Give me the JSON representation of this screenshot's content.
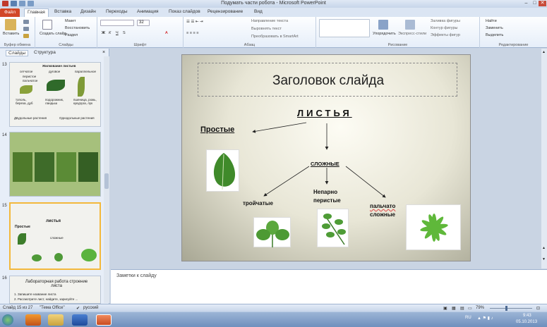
{
  "window": {
    "title": "Подумать части робота - Microsoft PowerPoint"
  },
  "tabs": {
    "file": "Файл",
    "items": [
      "Главная",
      "Вставка",
      "Дизайн",
      "Переходы",
      "Анимация",
      "Показ слайдов",
      "Рецензирование",
      "Вид"
    ]
  },
  "ribbon": {
    "clipboard": {
      "paste": "Вставить",
      "label": "Буфер обмена"
    },
    "slides": {
      "new_slide": "Создать слайд",
      "layout": "Макет",
      "reset": "Восстановить",
      "section": "Раздел",
      "label": "Слайды"
    },
    "font": {
      "size": "32",
      "label": "Шрифт"
    },
    "paragraph": {
      "text_direction": "Направление текста",
      "align_text": "Выровнять текст",
      "smartart": "Преобразовать в SmartArt",
      "label": "Абзац"
    },
    "drawing": {
      "arrange": "Упорядочить",
      "quick_styles": "Экспресс-стили",
      "fill": "Заливка фигуры",
      "outline": "Контур фигуры",
      "effects": "Эффекты фигур",
      "label": "Рисование"
    },
    "editing": {
      "find": "Найти",
      "replace": "Заменить",
      "select": "Выделить",
      "label": "Редактирование"
    }
  },
  "left_panel": {
    "tab_slides": "Слайды",
    "tab_outline": "Структура",
    "thumbs": [
      {
        "num": "13",
        "title": "Жилкование листьев",
        "c1": "сетчатое",
        "c2": "дуговое",
        "c3": "параллельное",
        "t1": "перистое",
        "t2": "пальчатое",
        "l1": "тополь, береза, дуб",
        "l2": "подорожник, ландыш",
        "l3": "пшеница, рожь, кукуруза, лук",
        "b1": "Двудольные растения",
        "b2": "Однодольные растения"
      },
      {
        "num": "14"
      },
      {
        "num": "15",
        "title": "листья",
        "left": "Простые",
        "mid": "сложные"
      },
      {
        "num": "16",
        "title": "Лабораторная работа строение листа",
        "l1": "1. Запишите название листа",
        "l2": "2. Рассмотрите лист, найдите, зарисуйте ..."
      }
    ]
  },
  "slide": {
    "title": "Заголовок слайда",
    "main": "ЛИСТЬЯ",
    "simple": "Простые",
    "compound": "СЛОЖНЫЕ",
    "trifoliate": "тройчатые",
    "pinnate_1": "Непарно",
    "pinnate_2": "перистые",
    "palmate_1": "пальчато",
    "palmate_2": "сложные"
  },
  "notes": {
    "placeholder": "Заметки к слайду"
  },
  "status": {
    "slide_counter": "Слайд 15 из 27",
    "theme": "\"Тема Office\"",
    "language": "русский",
    "zoom": "79%"
  },
  "taskbar": {
    "lang": "RU",
    "time": "9:43",
    "date": "05.10.2013"
  },
  "colors": {
    "accent_file": "#d24726",
    "selection": "#f3b83b",
    "ribbon_bg": "#e6eef9"
  }
}
